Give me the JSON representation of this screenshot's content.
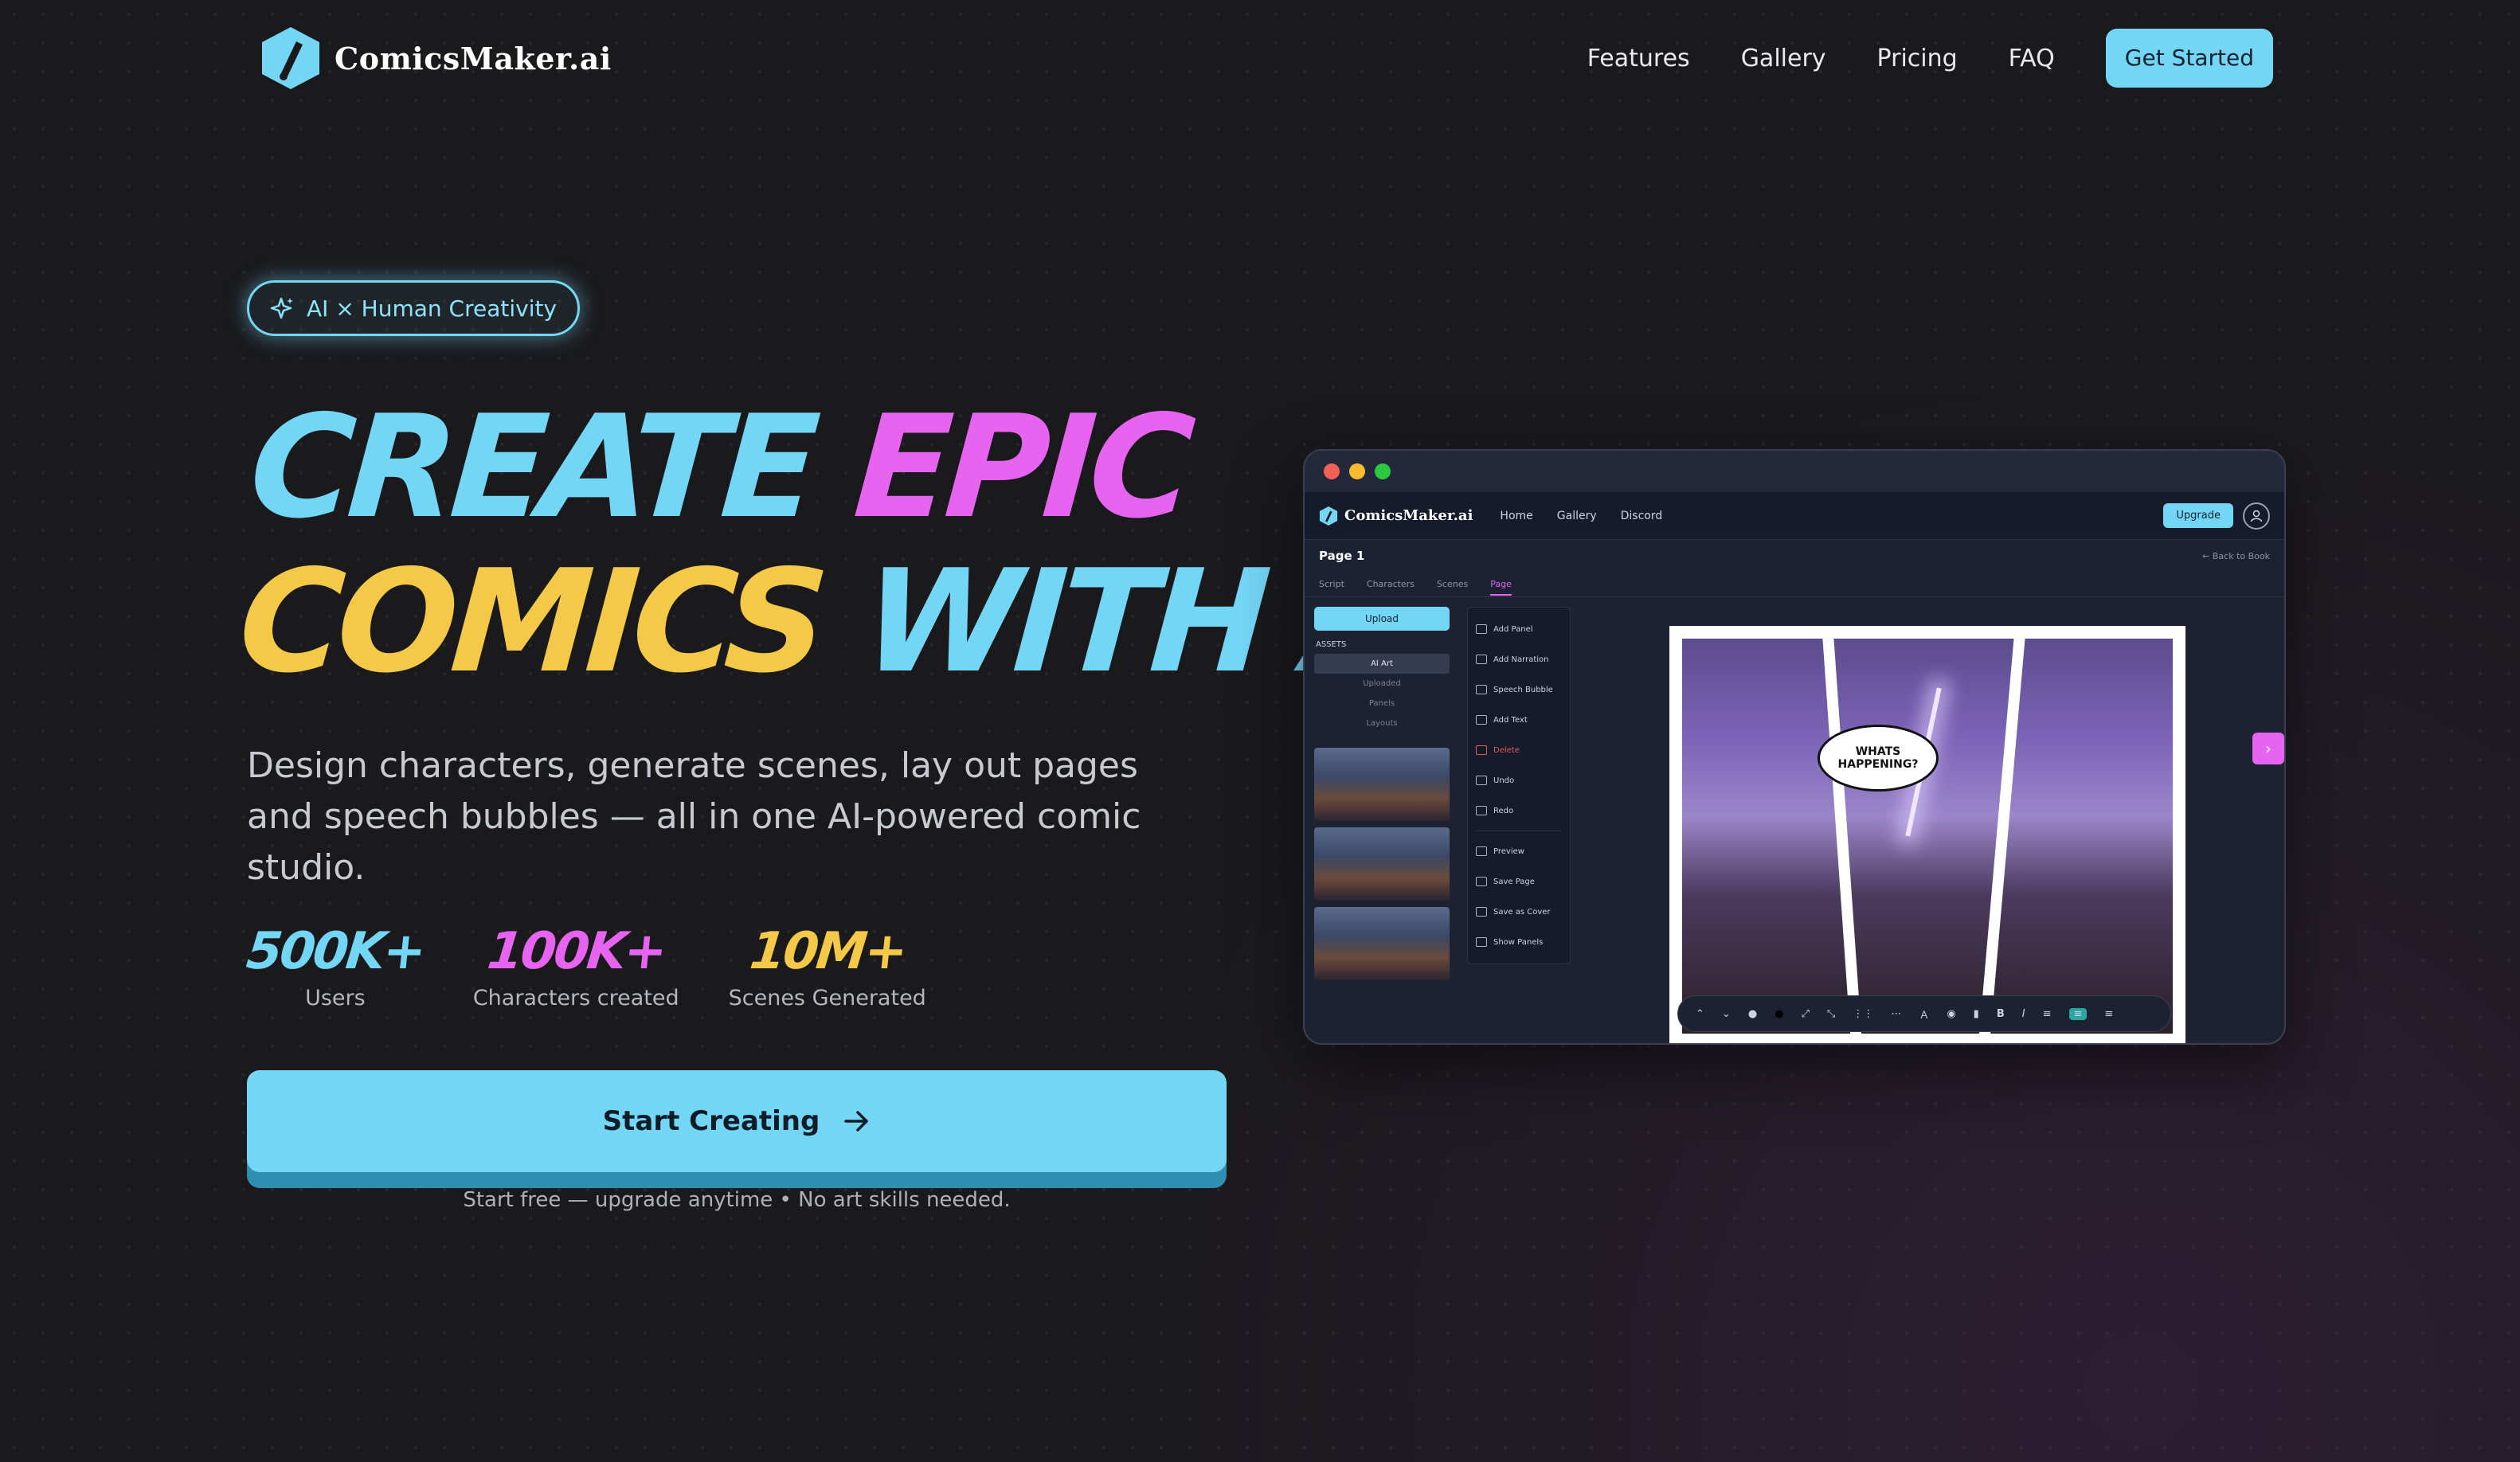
{
  "nav": {
    "brand": "ComicsMaker.ai",
    "links": [
      "Features",
      "Gallery",
      "Pricing",
      "FAQ"
    ],
    "cta": "Get Started"
  },
  "badge": "AI × Human Creativity",
  "headline": {
    "line1_a": "CREATE",
    "line1_b": "EPIC",
    "line2_a": "COMICS",
    "line2_b": "WITH AI"
  },
  "subtitle": "Design characters, generate scenes, lay out pages and speech bubbles — all in one AI-powered comic studio.",
  "stats": [
    {
      "value": "500K+",
      "label": "Users",
      "color": "#74d6f5"
    },
    {
      "value": "100K+",
      "label": "Characters created",
      "color": "#e664f0"
    },
    {
      "value": "10M+",
      "label": "Scenes Generated",
      "color": "#f5c948"
    }
  ],
  "cta": {
    "label": "Start Creating",
    "note": "Start free — upgrade anytime • No art skills needed."
  },
  "colors": {
    "accent": "#74d6f5",
    "pink": "#e664f0",
    "yellow": "#f5c948",
    "background": "#1a1a1d"
  },
  "app": {
    "brand": "ComicsMaker.ai",
    "nav_links": [
      "Home",
      "Gallery",
      "Discord"
    ],
    "upgrade": "Upgrade",
    "page_title": "Page 1",
    "back": "← Back to Book",
    "tabs": [
      "Script",
      "Characters",
      "Scenes",
      "Page"
    ],
    "active_tab": "Page",
    "upload": "Upload",
    "assets_label": "ASSETS",
    "asset_tabs": [
      "AI Art",
      "Uploaded",
      "Panels",
      "Layouts"
    ],
    "tools_group1": [
      "Add Panel",
      "Add Narration",
      "Speech Bubble",
      "Add Text",
      "Delete",
      "Undo",
      "Redo"
    ],
    "tools_group2": [
      "Preview",
      "Save Page",
      "Save as Cover",
      "Show Panels"
    ],
    "bubble": "WHATS HAPPENING?"
  }
}
